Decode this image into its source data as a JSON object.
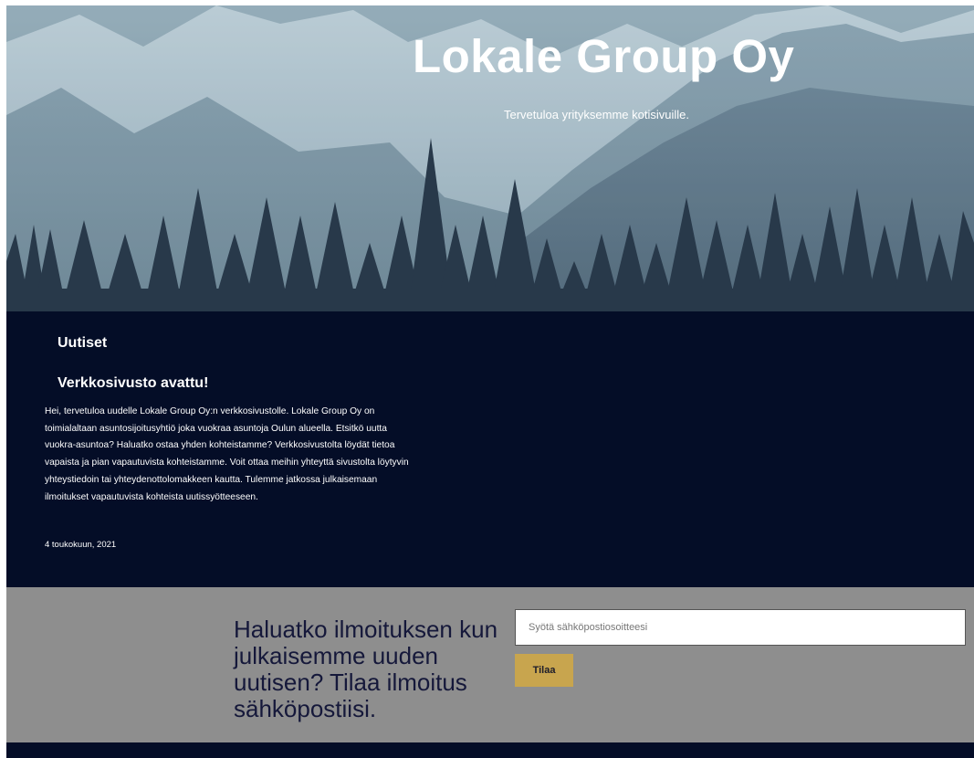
{
  "hero": {
    "title": "Lokale Group Oy",
    "subtitle": "Tervetuloa yrityksemme kotisivuille."
  },
  "news": {
    "heading": "Uutiset",
    "article": {
      "title": "Verkkosivusto avattu!",
      "body": "Hei, tervetuloa uudelle Lokale Group Oy:n verkkosivustolle. Lokale Group Oy on toimialaltaan asuntosijoitusyhtiö joka vuokraa asuntoja Oulun alueella. Etsitkö uutta vuokra-asuntoa? Haluatko ostaa yhden kohteistamme? Verkkosivustolta löydät tietoa vapaista ja pian vapautuvista kohteistamme. Voit ottaa meihin yhteyttä sivustolta löytyvin yhteystiedoin tai yhteydenottolomakkeen kautta. Tulemme jatkossa julkaisemaan ilmoitukset vapautuvista kohteista uutissyötteeseen.",
      "date": "4 toukokuun, 2021"
    }
  },
  "subscribe": {
    "text": "Haluatko ilmoituksen kun julkaisemme uuden uutisen? Tilaa ilmoitus sähköpostiisi.",
    "email_value": "",
    "email_placeholder": "Syötä sähköpostiosoitteesi",
    "button_label": "Tilaa"
  },
  "colors": {
    "news_background": "#040d27",
    "subscribe_background": "#8e8e8e",
    "button_accent": "#c8a54e",
    "footer_background": "#040d27"
  }
}
